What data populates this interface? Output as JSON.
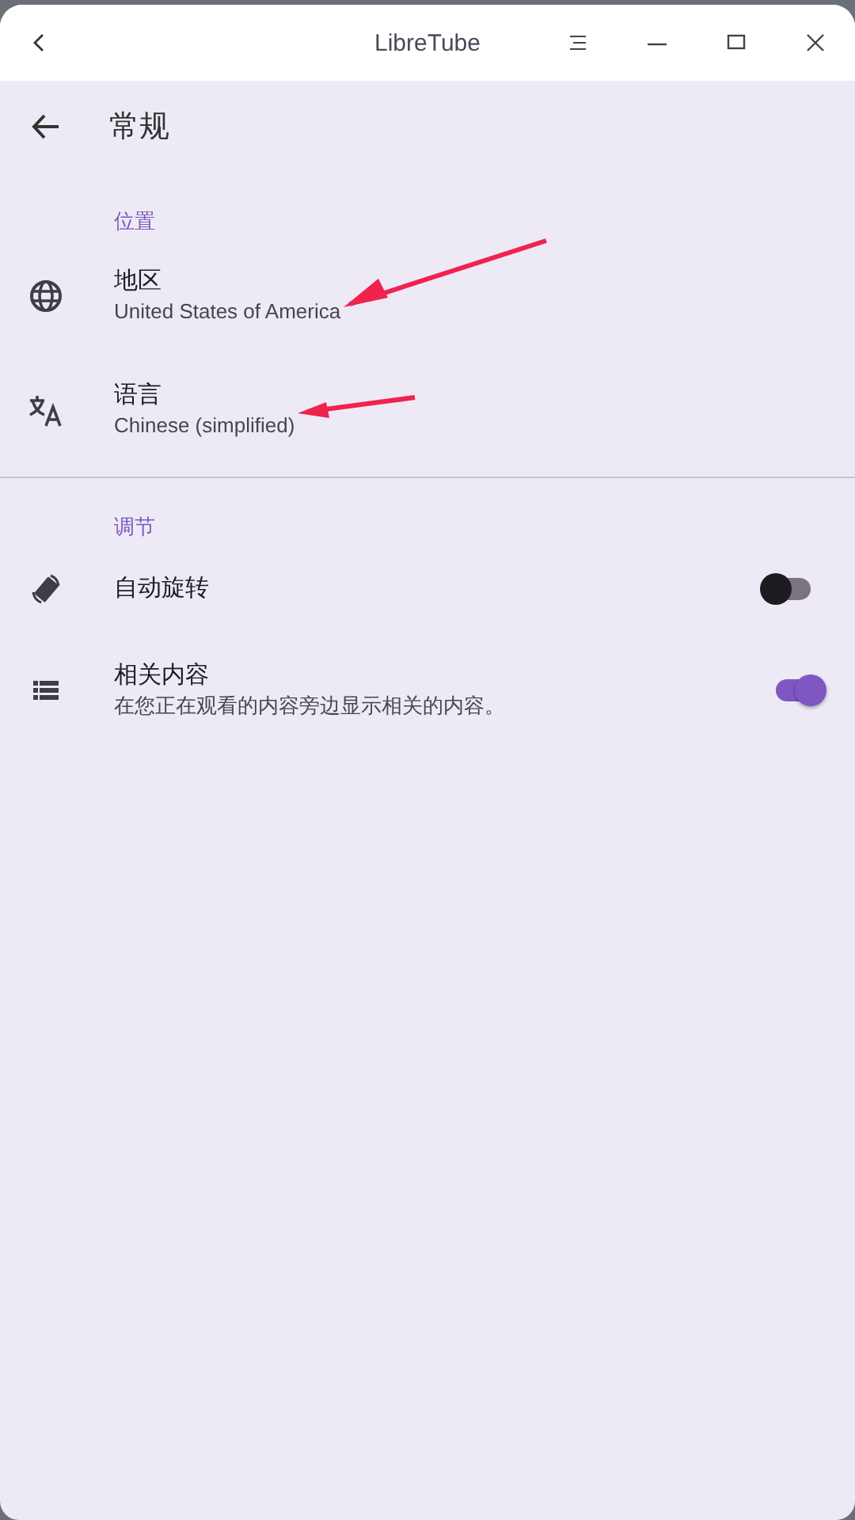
{
  "window": {
    "title": "LibreTube"
  },
  "page": {
    "title": "常规"
  },
  "sections": [
    {
      "title": "位置",
      "items": [
        {
          "kind": "link",
          "title": "地区",
          "summary": "United States of America",
          "annotated": true
        },
        {
          "kind": "link",
          "title": "语言",
          "summary": "Chinese (simplified)",
          "annotated": true
        }
      ]
    },
    {
      "title": "调节",
      "items": [
        {
          "kind": "switch",
          "title": "自动旋转",
          "on": false
        },
        {
          "kind": "switch",
          "title": "相关内容",
          "summary": "在您正在观看的内容旁边显示相关的内容。",
          "on": true
        }
      ]
    }
  ]
}
